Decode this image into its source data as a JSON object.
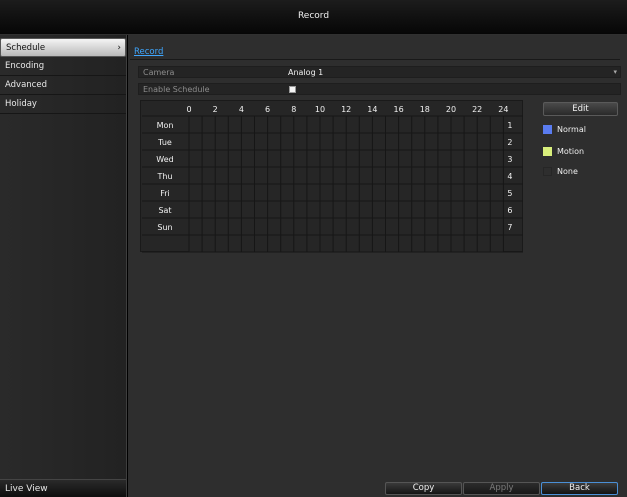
{
  "window": {
    "title": "Record"
  },
  "sidebar": {
    "items": [
      {
        "label": "Schedule",
        "active": true
      },
      {
        "label": "Encoding",
        "active": false
      },
      {
        "label": "Advanced",
        "active": false
      },
      {
        "label": "Holiday",
        "active": false
      }
    ],
    "chevron": "›",
    "live_view": "Live View"
  },
  "tabs": {
    "record": "Record"
  },
  "form": {
    "camera_label": "Camera",
    "camera_value": "Analog 1",
    "enable_schedule_label": "Enable Schedule",
    "enable_schedule_checked": false
  },
  "schedule": {
    "hour_labels": [
      "0",
      "2",
      "4",
      "6",
      "8",
      "10",
      "12",
      "14",
      "16",
      "18",
      "20",
      "22",
      "24"
    ],
    "days": [
      "Mon",
      "Tue",
      "Wed",
      "Thu",
      "Fri",
      "Sat",
      "Sun"
    ],
    "day_numbers": [
      "1",
      "2",
      "3",
      "4",
      "5",
      "6",
      "7"
    ]
  },
  "legend": {
    "edit_label": "Edit",
    "items": [
      {
        "label": "Normal",
        "color": "#5a7cf0"
      },
      {
        "label": "Motion",
        "color": "#d9ef7c"
      },
      {
        "label": "None",
        "color": "#2e2e2e"
      }
    ]
  },
  "buttons": {
    "copy": "Copy",
    "apply": "Apply",
    "back": "Back"
  }
}
